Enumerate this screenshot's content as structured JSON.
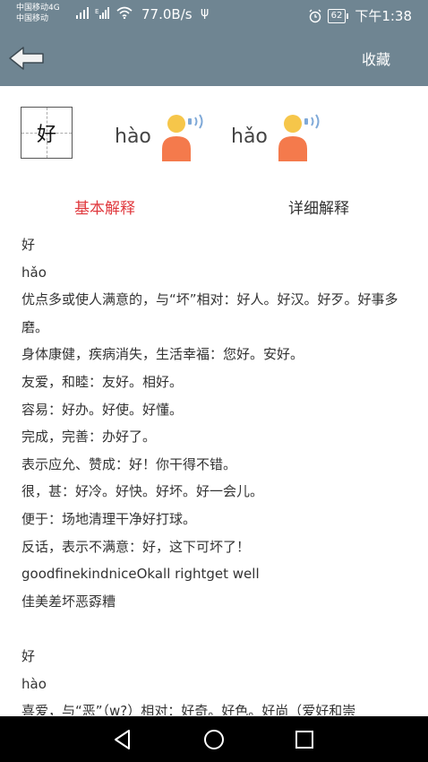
{
  "status_bar": {
    "carrier_line1": "中国移动4G",
    "carrier_line2": "中国移动",
    "network_speed": "77.0B/s",
    "battery": "62",
    "time": "下午1:38"
  },
  "app_bar": {
    "favorite_label": "收藏"
  },
  "character": {
    "glyph": "好",
    "pronunciations": [
      "hào",
      "hǎo"
    ]
  },
  "tabs": {
    "basic": "基本解释",
    "detailed": "详细解释"
  },
  "definitions": [
    {
      "char": "好",
      "pinyin": "hǎo",
      "lines": [
        "优点多或使人满意的，与“坏”相对：好人。好汉。好歹。好事多",
        "磨。",
        "身体康健，疾病消失，生活幸福：您好。安好。",
        "友爱，和睦：友好。相好。",
        "容易：好办。好使。好懂。",
        "完成，完善：办好了。",
        "表示应允、赞成：好！你干得不错。",
        "很，甚：好冷。好快。好坏。好一会儿。",
        "便于：场地清理干净好打球。",
        "反话，表示不满意：好，这下可坏了！",
        "goodfinekindniceOkall rightget well",
        "佳美差坏恶孬糟"
      ]
    },
    {
      "char": "好",
      "pinyin": "hào",
      "lines": [
        "喜爱，与“恶”（w?）相对：好奇。好色。好尚（爱好和崇"
      ]
    }
  ],
  "colors": {
    "bar_bg": "#6f8592",
    "tab_active": "#e0393e",
    "speaker_head": "#f6c64a",
    "speaker_body": "#f47a4c",
    "speaker_waves": "#7fa9d8"
  },
  "icons": {
    "back": "back-arrow-icon",
    "speaker": "speaker-person-icon",
    "nav": [
      "back-triangle-icon",
      "home-circle-icon",
      "recents-square-icon"
    ]
  }
}
